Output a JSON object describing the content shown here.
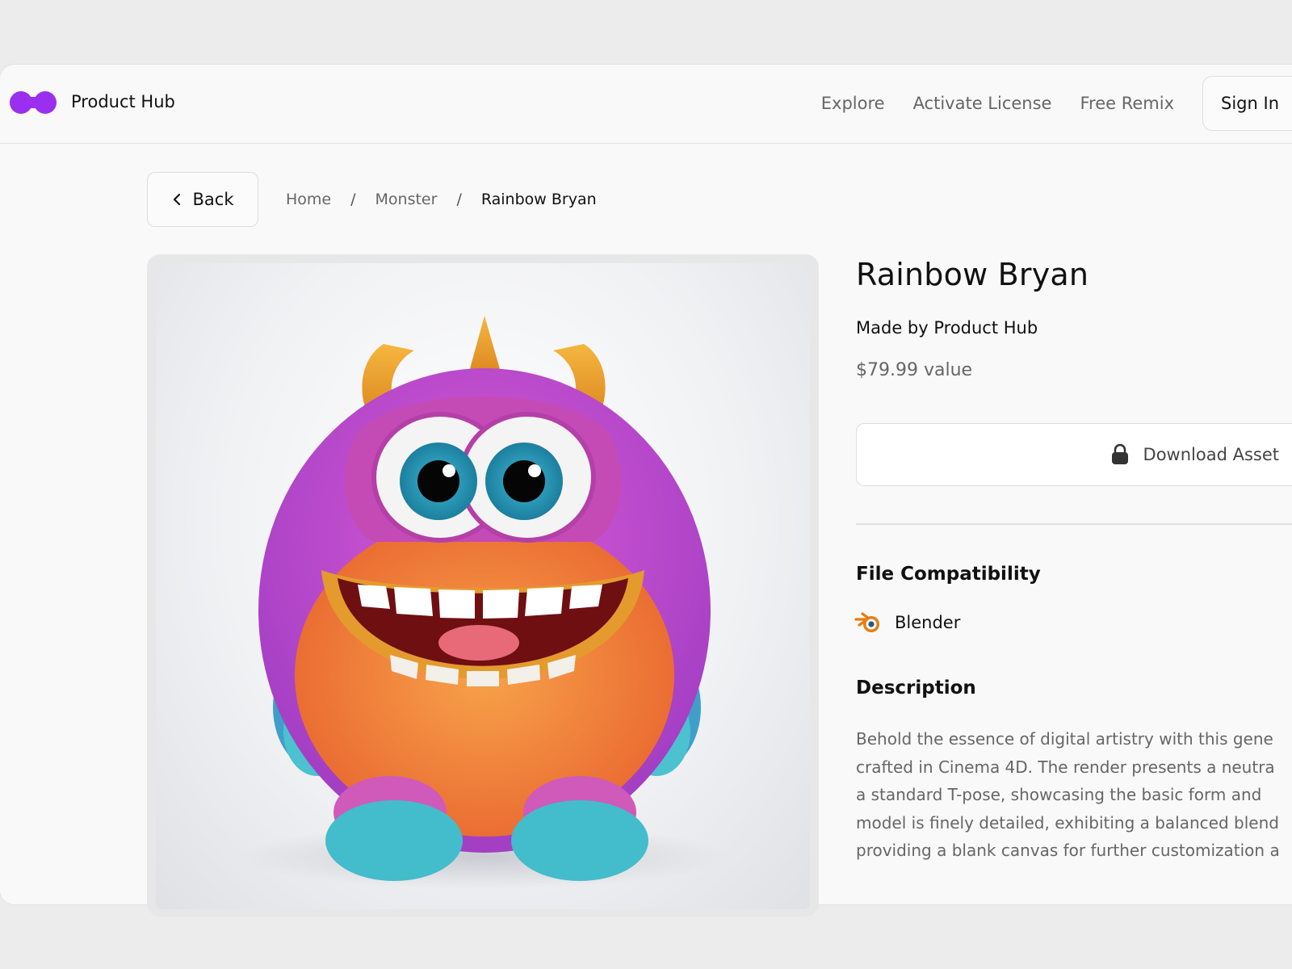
{
  "header": {
    "brand": "Product Hub",
    "nav": [
      "Explore",
      "Activate License",
      "Free Remix"
    ],
    "signin_label": "Sign In"
  },
  "breadcrumb": {
    "back_label": "Back",
    "items": [
      "Home",
      "Monster",
      "Rainbow Bryan"
    ],
    "separator": "/"
  },
  "product": {
    "title": "Rainbow Bryan",
    "maker": "Made by Product Hub",
    "price": "$79.99 value",
    "download_label": "Download Asset",
    "compat_heading": "File Compatibility",
    "compat_item": "Blender",
    "desc_heading": "Description",
    "description_lines": [
      "Behold the essence of digital artistry with this gene",
      "crafted in Cinema 4D. The render presents a neutra",
      "a standard T-pose, showcasing the basic form and",
      "model is finely detailed, exhibiting a balanced blend",
      "providing a blank canvas for further customization a"
    ]
  },
  "colors": {
    "brand_accent": "#9b2ff0",
    "blender_orange": "#e87d0d",
    "blender_blue": "#265787"
  },
  "icons": [
    "logo-icon",
    "chevron-left-icon",
    "lock-icon",
    "blender-icon"
  ]
}
